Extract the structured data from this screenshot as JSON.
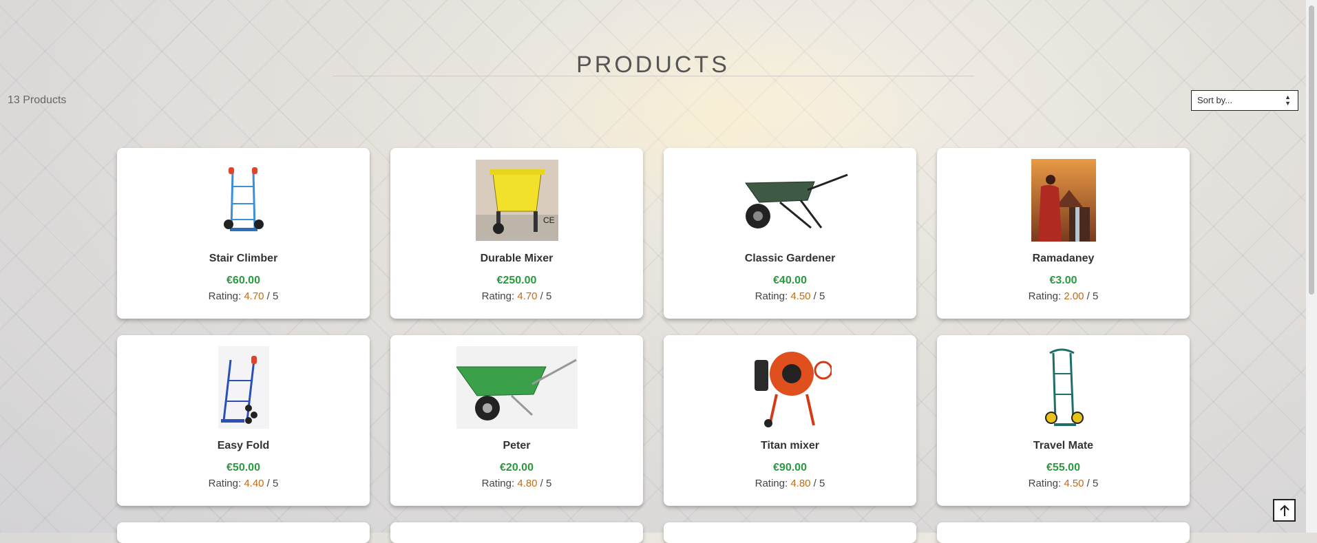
{
  "header": {
    "title": "PRODUCTS"
  },
  "toolbar": {
    "count_label": "13 Products",
    "sort_label": "Sort by..."
  },
  "products": [
    {
      "name": "Stair Climber",
      "price": "€60.00",
      "rating_prefix": "Rating: ",
      "rating": "4.70",
      "rating_suffix": " / 5",
      "icon": "hand-truck-blue"
    },
    {
      "name": "Durable Mixer",
      "price": "€250.00",
      "rating_prefix": "Rating: ",
      "rating": "4.70",
      "rating_suffix": " / 5",
      "icon": "yellow-mixer"
    },
    {
      "name": "Classic Gardener",
      "price": "€40.00",
      "rating_prefix": "Rating: ",
      "rating": "4.50",
      "rating_suffix": " / 5",
      "icon": "dark-wheelbarrow"
    },
    {
      "name": "Ramadaney",
      "price": "€3.00",
      "rating_prefix": "Rating: ",
      "rating": "2.00",
      "rating_suffix": " / 5",
      "icon": "desert-scene"
    },
    {
      "name": "Easy Fold",
      "price": "€50.00",
      "rating_prefix": "Rating: ",
      "rating": "4.40",
      "rating_suffix": " / 5",
      "icon": "hand-truck-stair"
    },
    {
      "name": "Peter",
      "price": "€20.00",
      "rating_prefix": "Rating: ",
      "rating": "4.80",
      "rating_suffix": " / 5",
      "icon": "green-wheelbarrow"
    },
    {
      "name": "Titan mixer",
      "price": "€90.00",
      "rating_prefix": "Rating: ",
      "rating": "4.80",
      "rating_suffix": " / 5",
      "icon": "orange-mixer"
    },
    {
      "name": "Travel Mate",
      "price": "€55.00",
      "rating_prefix": "Rating: ",
      "rating": "4.50",
      "rating_suffix": " / 5",
      "icon": "green-hand-truck"
    }
  ],
  "colors": {
    "price": "#2a9a3e",
    "rating": "#c46a10"
  },
  "back_to_top": {
    "icon": "arrow-up-icon"
  }
}
